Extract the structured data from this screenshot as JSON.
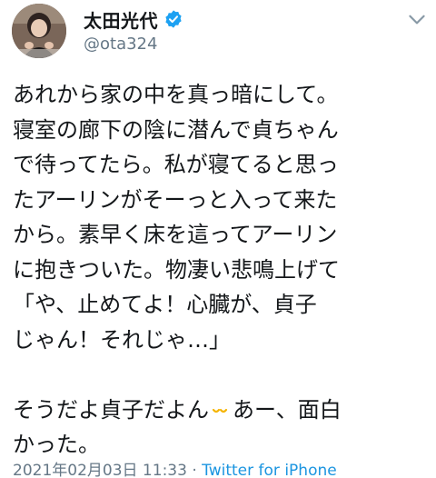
{
  "author": {
    "display_name": "太田光代",
    "handle": "@ota324",
    "verified": true
  },
  "tweet": {
    "lines": [
      "あれから家の中を真っ暗にして。",
      "寝室の廊下の陰に潜んで貞ちゃん",
      "で待ってたら。私が寝てると思っ",
      "たアーリンがそーっと入って来た",
      "から。素早く床を這ってアーリン",
      "に抱きついた。物凄い悲鳴上げて",
      "「や、止めてよ！心臓が、貞子",
      "じゃん！それじゃ…」",
      "",
      "そうだよ貞子だよん",
      "あー、面白",
      "かった。"
    ],
    "emoji_name": "smiling-eyes-emoji"
  },
  "meta": {
    "timestamp": "2021年02月03日 11:33",
    "separator": "·",
    "source": "Twitter for iPhone"
  },
  "colors": {
    "verified_badge": "#1da1f2",
    "link": "#1b95e0",
    "secondary_text": "#657786"
  }
}
